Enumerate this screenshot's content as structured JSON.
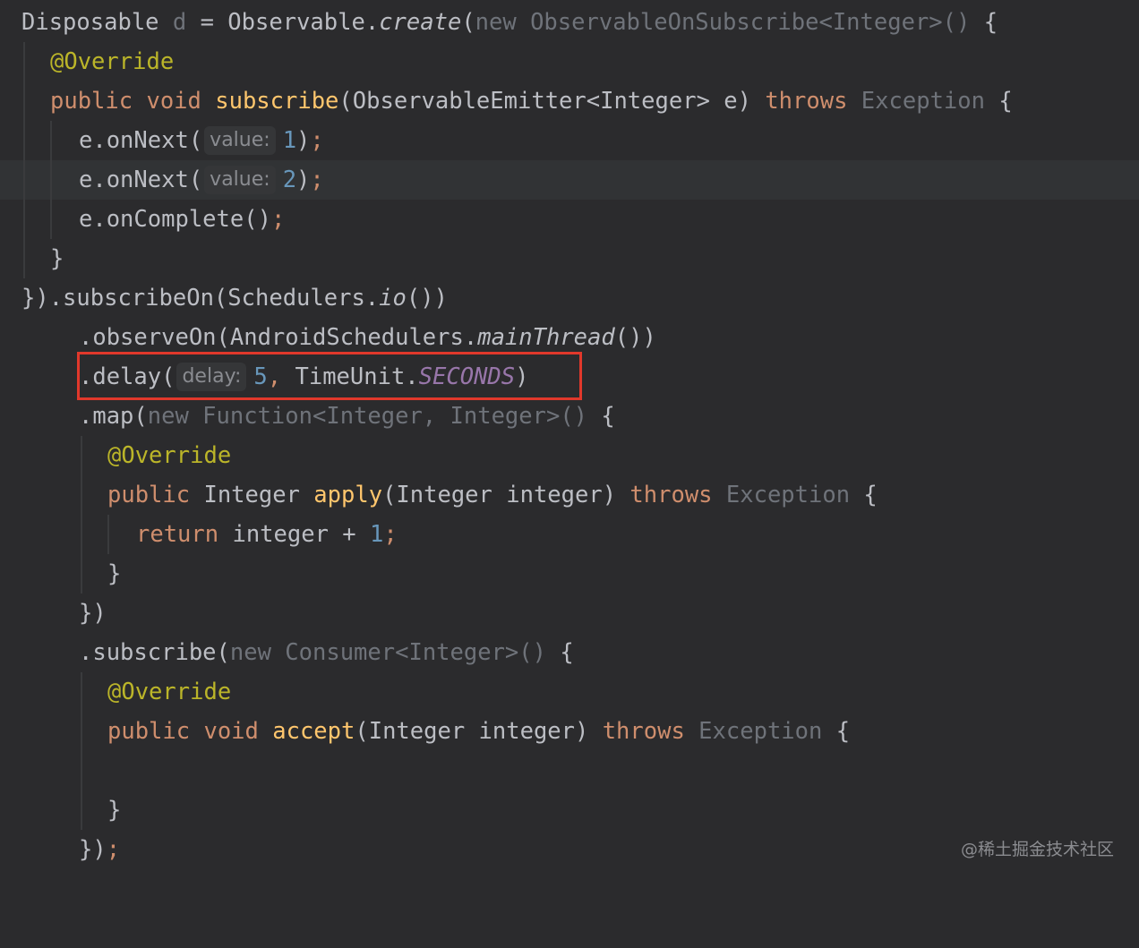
{
  "code": {
    "l1": {
      "t1": "Disposable ",
      "t2": "d",
      "t3": " = Observable.",
      "t4": "create",
      "t5": "(",
      "t6": "new ObservableOnSubscribe<Integer>()",
      "t7": " {"
    },
    "l2": {
      "t1": "@Override"
    },
    "l3": {
      "t1": "public void ",
      "t2": "subscribe",
      "t3": "(ObservableEmitter<Integer> e) ",
      "t4": "throws",
      "t5": " Exception",
      "t6": " {"
    },
    "l4": {
      "t1": "e.onNext(",
      "hint": "value:",
      "t2": "1",
      "t3": ")",
      "t4": ";"
    },
    "l5": {
      "t1": "e.onNext(",
      "hint": "value:",
      "t2": "2",
      "t3": ")",
      "t4": ";"
    },
    "l6": {
      "t1": "e.onComplete()",
      "t2": ";"
    },
    "l7": {
      "t1": "}"
    },
    "l8": {
      "t1": "}).subscribeOn(Schedulers.",
      "t2": "io",
      "t3": "())"
    },
    "l9": {
      "t1": ".observeOn(AndroidSchedulers.",
      "t2": "mainThread",
      "t3": "())"
    },
    "l10": {
      "t1": ".delay(",
      "hint": "delay:",
      "t2": "5",
      "t3": ", ",
      "t4": "TimeUnit.",
      "t5": "SECONDS",
      "t6": ")"
    },
    "l11": {
      "t1": ".map(",
      "t2": "new Function<Integer, Integer>()",
      "t3": " {"
    },
    "l12": {
      "t1": "@Override"
    },
    "l13": {
      "t1": "public ",
      "t2": "Integer ",
      "t3": "apply",
      "t4": "(Integer integer) ",
      "t5": "throws",
      "t6": " Exception",
      "t7": " {"
    },
    "l14": {
      "t1": "return ",
      "t2": "integer + ",
      "t3": "1",
      "t4": ";"
    },
    "l15": {
      "t1": "}"
    },
    "l16": {
      "t1": "})"
    },
    "l17": {
      "t1": ".subscribe(",
      "t2": "new Consumer<Integer>()",
      "t3": " {"
    },
    "l18": {
      "t1": "@Override"
    },
    "l19": {
      "t1": "public void ",
      "t2": "accept",
      "t3": "(Integer integer) ",
      "t4": "throws",
      "t5": " Exception",
      "t6": " {"
    },
    "l20": {
      "t1": ""
    },
    "l21": {
      "t1": "}"
    },
    "l22": {
      "t1": "})",
      "t2": ";"
    }
  },
  "watermark": "@稀土掘金技术社区",
  "colors": {
    "background": "#2b2b2d",
    "keyword": "#cf8e6d",
    "function": "#ffc66d",
    "annotation": "#bbb529",
    "number": "#6897bb",
    "constant": "#9876aa",
    "highlight_box": "#e1382b"
  }
}
